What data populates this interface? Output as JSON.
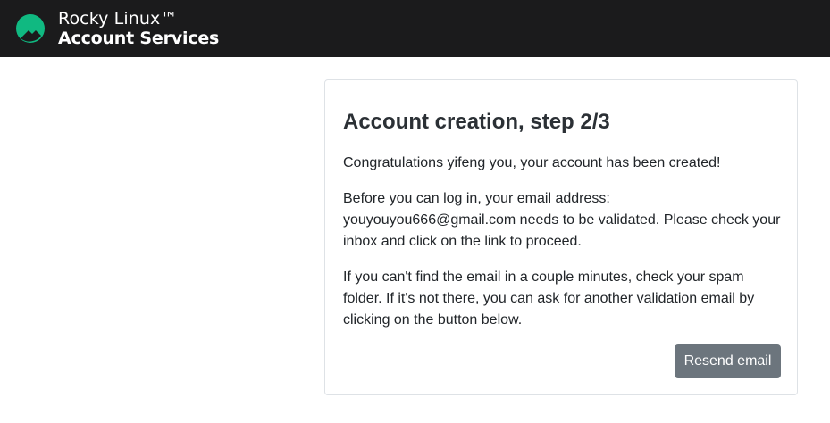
{
  "header": {
    "brand_line1": "Rocky Linux™",
    "brand_line2": "Account Services",
    "logo_icon": "rocky-linux-logo-icon",
    "logo_color": "#10b981",
    "background_color": "#1b1b1c"
  },
  "card": {
    "title": "Account creation, step 2/3",
    "paragraph1": "Congratulations yifeng you, your account has been created!",
    "paragraph2": "Before you can log in, your email address: youyouyou666@gmail.com needs to be validated. Please check your inbox and click on the link to proceed.",
    "paragraph3": "If you can't find the email in a couple minutes, check your spam folder. If it's not there, you can ask for another validation email by clicking on the button below.",
    "resend_button_label": "Resend email",
    "button_color": "#6c757d"
  }
}
